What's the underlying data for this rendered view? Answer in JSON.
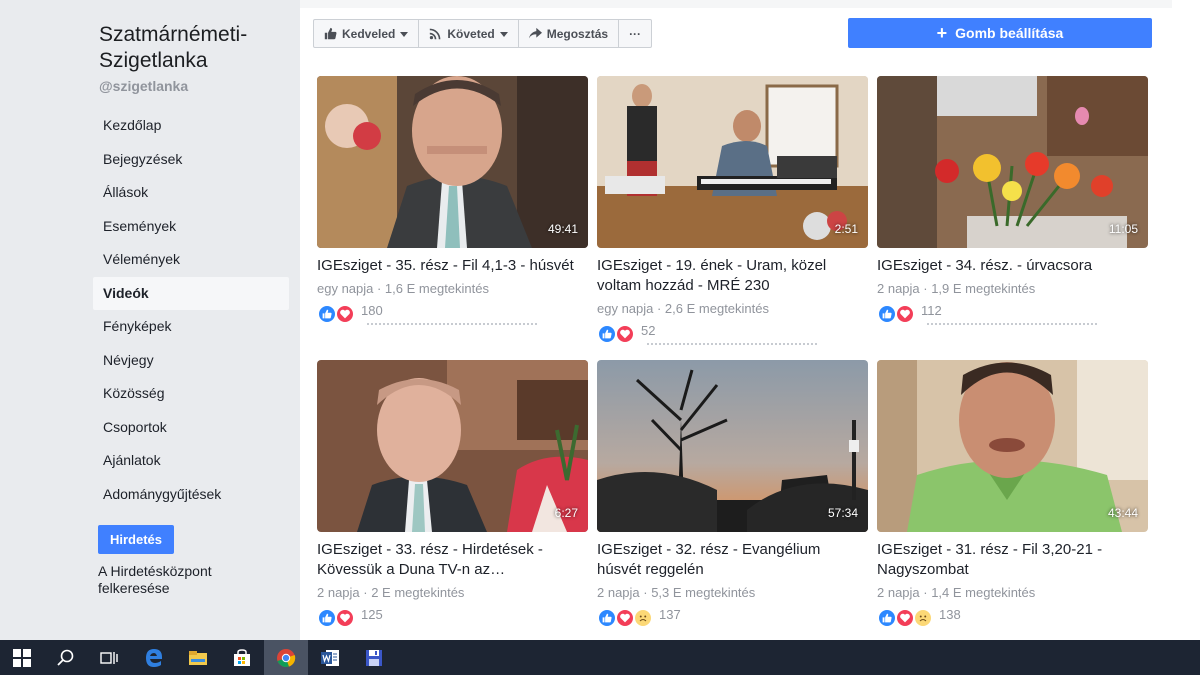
{
  "page": {
    "name": "Szatmárnémeti-Szigetlanka",
    "handle": "@szigetlanka"
  },
  "sidebar": {
    "items": [
      {
        "label": "Kezdőlap"
      },
      {
        "label": "Bejegyzések"
      },
      {
        "label": "Állások"
      },
      {
        "label": "Események"
      },
      {
        "label": "Vélemények"
      },
      {
        "label": "Videók",
        "active": true
      },
      {
        "label": "Fényképek"
      },
      {
        "label": "Névjegy"
      },
      {
        "label": "Közösség"
      },
      {
        "label": "Csoportok"
      },
      {
        "label": "Ajánlatok"
      },
      {
        "label": "Adománygyűjtések"
      }
    ],
    "promote_label": "Hirdetés",
    "ad_center_label": "A Hirdetésközpont felkeresése"
  },
  "actions": {
    "like_label": "Kedveled",
    "follow_label": "Követed",
    "share_label": "Megosztás",
    "more_label": "···",
    "setup_label": "Gomb beállítása"
  },
  "videos": [
    {
      "title": "IGEsziget - 35. rész - Fil 4,1-3 - húsvét",
      "meta": "egy napja · 1,6 E megtekintés",
      "duration": "49:41",
      "reactions": 180
    },
    {
      "title": "IGEsziget - 19. ének - Uram, közel voltam hozzád - MRÉ 230",
      "meta": "egy napja · 2,6 E megtekintés",
      "duration": "2:51",
      "reactions": 52
    },
    {
      "title": "IGEsziget - 34. rész. - úrvacsora",
      "meta": "2 napja · 1,9 E megtekintés",
      "duration": "11:05",
      "reactions": 112
    },
    {
      "title": "IGEsziget - 33. rész - Hirdetések - Kövessük a Duna TV-n az…",
      "meta": "2 napja · 2 E megtekintés",
      "duration": "6:27",
      "reactions": 125
    },
    {
      "title": "IGEsziget - 32. rész - Evangélium húsvét reggelén",
      "meta": "2 napja · 5,3 E megtekintés",
      "duration": "57:34",
      "reactions": 137
    },
    {
      "title": "IGEsziget - 31. rész - Fil 3,20-21 - Nagyszombat",
      "meta": "2 napja · 1,4 E megtekintés",
      "duration": "43:44",
      "reactions": 138
    }
  ],
  "colors": {
    "accent": "#4080ff",
    "sidebar_bg": "#e9ebee",
    "taskbar_bg": "#1d2533"
  },
  "taskbar": {
    "icons": [
      "windows-start-icon",
      "search-icon",
      "task-view-icon",
      "edge-icon",
      "file-explorer-icon",
      "store-icon",
      "chrome-icon",
      "word-icon",
      "save-icon"
    ]
  }
}
